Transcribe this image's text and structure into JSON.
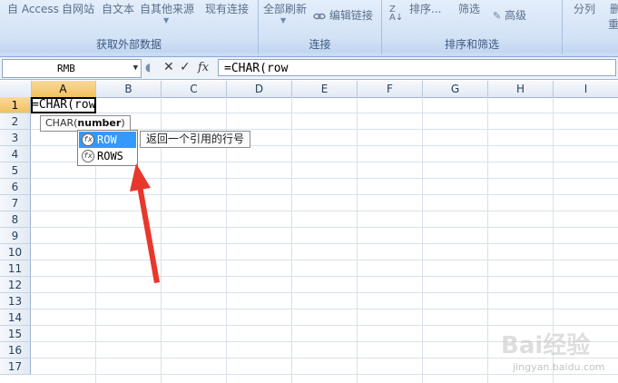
{
  "ribbon": {
    "groups": [
      {
        "label": "获取外部数据",
        "items": [
          "自 Access",
          "自网站",
          "自文本",
          "自其他来源",
          "现有连接"
        ]
      },
      {
        "label": "连接",
        "items": [
          "全部刷新",
          "编辑链接"
        ]
      },
      {
        "label": "排序和筛选",
        "items": [
          "排序...",
          "筛选",
          "高级"
        ]
      },
      {
        "label": "",
        "items": [
          "分列",
          "删",
          "重"
        ]
      }
    ]
  },
  "formula_bar": {
    "name_box": "RMB",
    "formula": "=CHAR(row"
  },
  "grid": {
    "columns": [
      "A",
      "B",
      "C",
      "D",
      "E",
      "F",
      "G",
      "H",
      "I"
    ],
    "rows": [
      "1",
      "2",
      "3",
      "4",
      "5",
      "6",
      "7",
      "8",
      "9",
      "10",
      "11",
      "12",
      "13",
      "14",
      "15",
      "16",
      "17"
    ],
    "active_cell_text": "=CHAR(row",
    "selected_column": "A",
    "selected_row": "1"
  },
  "tooltip": {
    "func": "CHAR(",
    "arg": "number",
    "close": ")"
  },
  "autocomplete": {
    "items": [
      "ROW",
      "ROWS"
    ],
    "highlighted": "ROW",
    "description": "返回一个引用的行号"
  },
  "watermark": {
    "text": "Bai经验",
    "sub": "jingyan.baidu.com"
  },
  "colors": {
    "arrow": "#e8372c",
    "highlight": "#3399ff"
  }
}
